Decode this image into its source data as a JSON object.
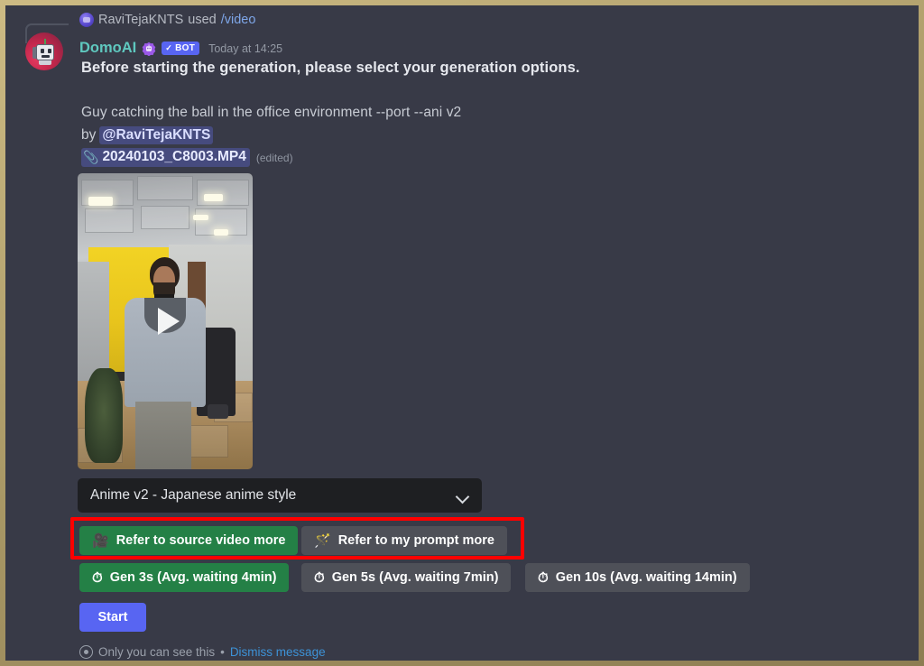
{
  "command_line": {
    "username": "RaviTejaKNTS",
    "used_label": "used",
    "command": "/video",
    "avatar_icon": "user-avatar-icon"
  },
  "message": {
    "bot_name": "DomoAI",
    "verified_icon": "verified-bot-icon",
    "bot_tag": "BOT",
    "bot_tag_check": "✓",
    "timestamp": "Today at 14:25",
    "headline": "Before starting the generation, please select your generation options.",
    "avatar_icon": "domoai-robot-avatar-icon"
  },
  "embed": {
    "prompt": "Guy catching the ball in the office environment --port --ani v2",
    "by_label": "by",
    "mention": "@RaviTejaKNTS",
    "attachment_icon": "📎",
    "attachment_name": "20240103_C8003.MP4",
    "edited_label": "(edited)",
    "video_thumbnail": {
      "play_icon": "play-button-icon",
      "alt": "man standing in office with yellow wall"
    }
  },
  "style_select": {
    "value": "Anime v2 - Japanese anime style",
    "chevron_icon": "chevron-down-icon"
  },
  "reference_buttons": [
    {
      "label": "Refer to source video more",
      "icon": "🎥",
      "icon_name": "movie-camera-icon",
      "style": "green",
      "selected": true
    },
    {
      "label": "Refer to my prompt more",
      "icon": "🪄",
      "icon_name": "magic-wand-icon",
      "style": "grey",
      "selected": false
    }
  ],
  "duration_buttons": [
    {
      "label": "Gen 3s (Avg. waiting 4min)",
      "icon": "⏱",
      "icon_name": "stopwatch-icon",
      "style": "green",
      "selected": true
    },
    {
      "label": "Gen 5s (Avg. waiting 7min)",
      "icon": "⏱",
      "icon_name": "stopwatch-icon",
      "style": "grey",
      "selected": false
    },
    {
      "label": "Gen 10s (Avg. waiting 14min)",
      "icon": "⏱",
      "icon_name": "stopwatch-icon",
      "style": "grey",
      "selected": false
    }
  ],
  "start_button": {
    "label": "Start"
  },
  "footer": {
    "visibility_icon": "eye-icon",
    "visibility_text": "Only you can see this",
    "separator": "•",
    "dismiss_label": "Dismiss message"
  },
  "annotation": {
    "type": "red-highlight-rectangle",
    "color": "#ff0000",
    "targets": "reference-buttons-row"
  },
  "colors": {
    "background": "#383a47",
    "green": "#248046",
    "grey": "#4e5058",
    "blurple": "#5865f2",
    "bot_name": "#5fc8bf",
    "link": "#3d92d6",
    "mention_bg": "#464b7e",
    "annotation_red": "#ff0000",
    "frame": "#b9a87a"
  }
}
